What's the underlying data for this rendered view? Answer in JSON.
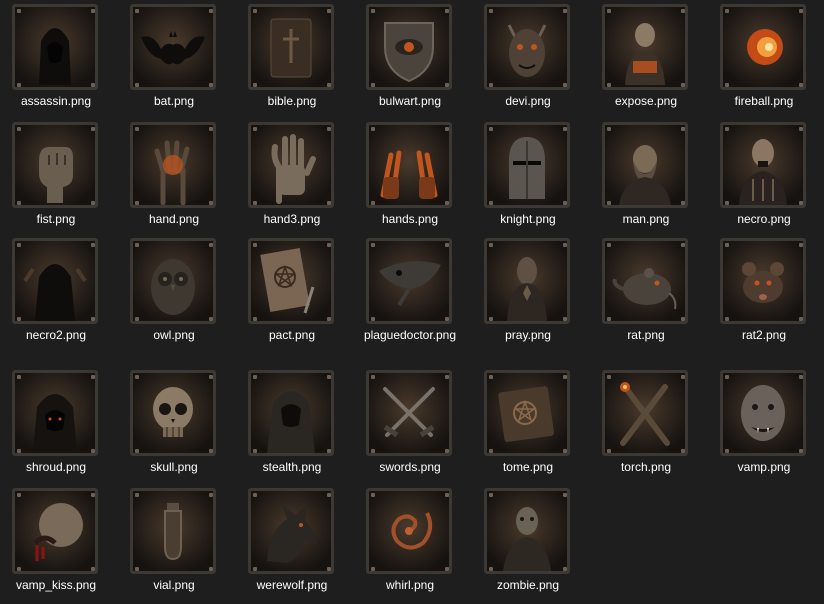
{
  "window": {
    "view": "large-icons"
  },
  "files": [
    {
      "name": "assassin.png",
      "icon": "hooded-figure-icon"
    },
    {
      "name": "bat.png",
      "icon": "bat-icon"
    },
    {
      "name": "bible.png",
      "icon": "bible-icon"
    },
    {
      "name": "bulwart.png",
      "icon": "eye-shield-icon"
    },
    {
      "name": "devi.png",
      "icon": "demon-face-icon"
    },
    {
      "name": "expose.png",
      "icon": "man-with-book-icon"
    },
    {
      "name": "fireball.png",
      "icon": "fireball-icon"
    },
    {
      "name": "fist.png",
      "icon": "fist-icon"
    },
    {
      "name": "hand.png",
      "icon": "glowing-hand-icon"
    },
    {
      "name": "hand3.png",
      "icon": "open-hand-icon"
    },
    {
      "name": "hands.png",
      "icon": "burning-hands-icon"
    },
    {
      "name": "knight.png",
      "icon": "knight-helmet-icon"
    },
    {
      "name": "man.png",
      "icon": "bearded-man-icon"
    },
    {
      "name": "necro.png",
      "icon": "necromancer-icon"
    },
    {
      "name": "necro2.png",
      "icon": "hooded-necromancer-icon"
    },
    {
      "name": "owl.png",
      "icon": "owl-icon"
    },
    {
      "name": "pact.png",
      "icon": "pentagram-scroll-icon"
    },
    {
      "name": "plaguedoctor.png",
      "icon": "plague-mask-icon"
    },
    {
      "name": "pray.png",
      "icon": "praying-figure-icon"
    },
    {
      "name": "rat.png",
      "icon": "rat-icon"
    },
    {
      "name": "rat2.png",
      "icon": "rat-head-icon"
    },
    {
      "name": "shroud.png",
      "icon": "shroud-icon"
    },
    {
      "name": "skull.png",
      "icon": "skull-icon"
    },
    {
      "name": "stealth.png",
      "icon": "stealth-cloak-icon"
    },
    {
      "name": "swords.png",
      "icon": "crossed-swords-icon"
    },
    {
      "name": "tome.png",
      "icon": "tome-icon"
    },
    {
      "name": "torch.png",
      "icon": "crossed-torches-icon"
    },
    {
      "name": "vamp.png",
      "icon": "vampire-face-icon"
    },
    {
      "name": "vamp_kiss.png",
      "icon": "vampire-kiss-icon"
    },
    {
      "name": "vial.png",
      "icon": "vial-icon"
    },
    {
      "name": "werewolf.png",
      "icon": "werewolf-icon"
    },
    {
      "name": "whirl.png",
      "icon": "whirl-icon"
    },
    {
      "name": "zombie.png",
      "icon": "zombie-icon"
    }
  ],
  "colors": {
    "background": "#1e1e1e",
    "label": "#ffffff",
    "frame": "#3c3833",
    "ember": "#c2551e",
    "shadow": "#0e0c0b"
  }
}
